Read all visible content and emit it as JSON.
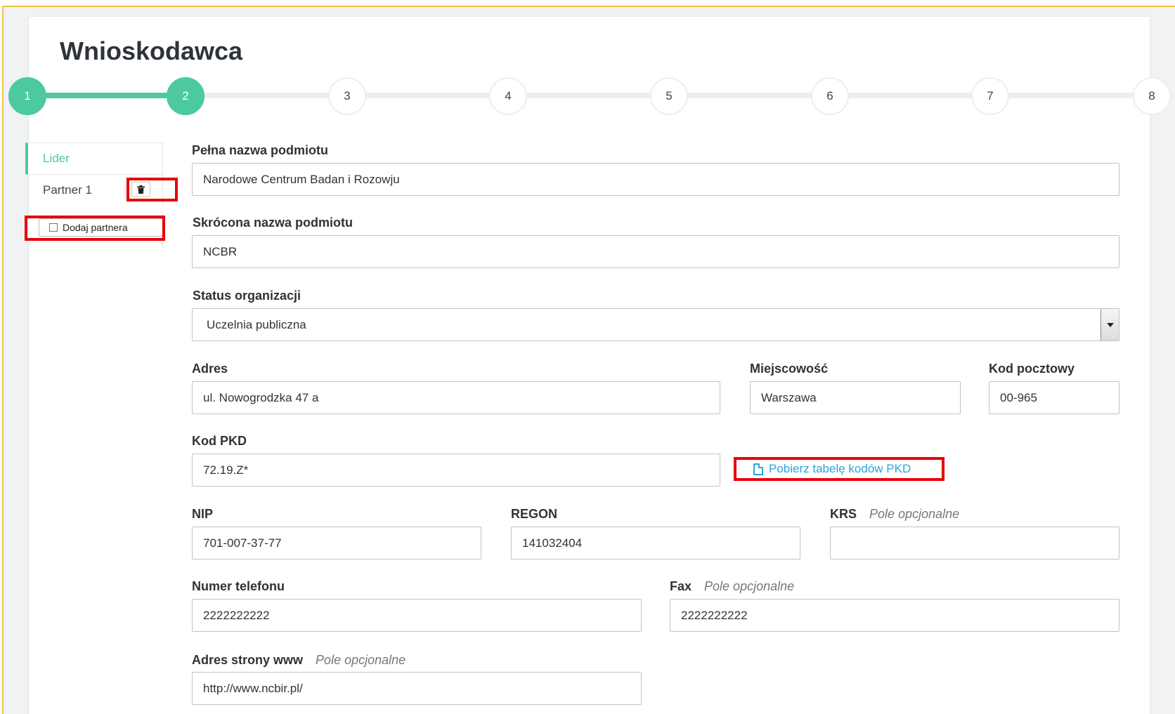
{
  "page": {
    "title": "Wnioskodawca"
  },
  "stepper": {
    "steps": [
      "1",
      "2",
      "3",
      "4",
      "5",
      "6",
      "7",
      "8"
    ],
    "completed_count": 2,
    "accent_color": "#4cc9a0"
  },
  "side_nav": {
    "items": [
      {
        "label": "Lider",
        "active": true
      },
      {
        "label": "Partner 1",
        "active": false,
        "icon": "trash-icon"
      }
    ],
    "add_partner_label": "Dodaj partnera"
  },
  "form": {
    "full_name": {
      "label": "Pełna nazwa podmiotu",
      "value": "Narodowe Centrum Badan i Rozowju"
    },
    "short_name": {
      "label": "Skrócona nazwa podmiotu",
      "value": "NCBR"
    },
    "org_status": {
      "label": "Status organizacji",
      "value": "Uczelnia publiczna"
    },
    "address": {
      "label": "Adres",
      "value": "ul. Nowogrodzka 47 a"
    },
    "city": {
      "label": "Miejscowość",
      "value": "Warszawa"
    },
    "postal_code": {
      "label": "Kod pocztowy",
      "value": "00-965"
    },
    "pkd": {
      "label": "Kod PKD",
      "value": "72.19.Z*",
      "download_link": "Pobierz tabelę kodów PKD"
    },
    "nip": {
      "label": "NIP",
      "value": "701-007-37-77"
    },
    "regon": {
      "label": "REGON",
      "value": "141032404"
    },
    "krs": {
      "label": "KRS",
      "optional": "Pole opcjonalne",
      "value": ""
    },
    "phone": {
      "label": "Numer telefonu",
      "value": "2222222222"
    },
    "fax": {
      "label": "Fax",
      "optional": "Pole opcjonalne",
      "value": "2222222222"
    },
    "website": {
      "label": "Adres strony www",
      "optional": "Pole opcjonalne",
      "value": "http://www.ncbir.pl/"
    }
  },
  "highlight_color": "#e8000b"
}
